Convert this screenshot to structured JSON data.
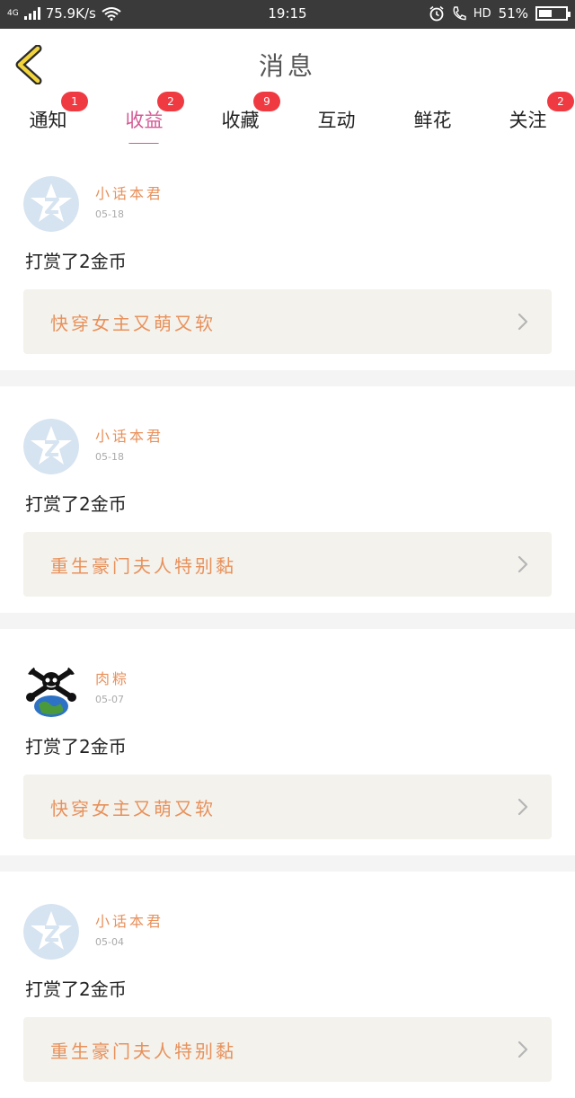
{
  "status_bar": {
    "network": "4G",
    "speed": "75.9K/s",
    "time": "19:15",
    "hd": "HD",
    "battery": "51%",
    "battery_level": 0.51
  },
  "header": {
    "back_icon": "chevron-left-icon",
    "title": "消息"
  },
  "tabs": [
    {
      "label": "通知",
      "badge": "1",
      "active": false
    },
    {
      "label": "收益",
      "badge": "2",
      "active": true
    },
    {
      "label": "收藏",
      "badge": "9",
      "active": false
    },
    {
      "label": "互动",
      "badge": "",
      "active": false
    },
    {
      "label": "鲜花",
      "badge": "",
      "active": false
    },
    {
      "label": "关注",
      "badge": "2",
      "active": false
    }
  ],
  "messages": [
    {
      "user": "小话本君",
      "date": "05-18",
      "action": "打赏了2金币",
      "book": "快穿女主又萌又软",
      "avatar": "qq-default-avatar"
    },
    {
      "user": "小话本君",
      "date": "05-18",
      "action": "打赏了2金币",
      "book": "重生豪门夫人特别黏",
      "avatar": "qq-default-avatar"
    },
    {
      "user": "肉粽",
      "date": "05-07",
      "action": "打赏了2金币",
      "book": "快穿女主又萌又软",
      "avatar": "pirate-globe-avatar"
    },
    {
      "user": "小话本君",
      "date": "05-04",
      "action": "打赏了2金币",
      "book": "重生豪门夫人特别黏",
      "avatar": "qq-default-avatar"
    }
  ],
  "colors": {
    "accent_pink": "#d45a96",
    "orange_text": "#e8915b",
    "badge_red": "#ef3a42",
    "book_bg": "#f3f2ed",
    "status_bg": "#3a3a3a",
    "back_icon_yellow": "#f2d43c"
  }
}
